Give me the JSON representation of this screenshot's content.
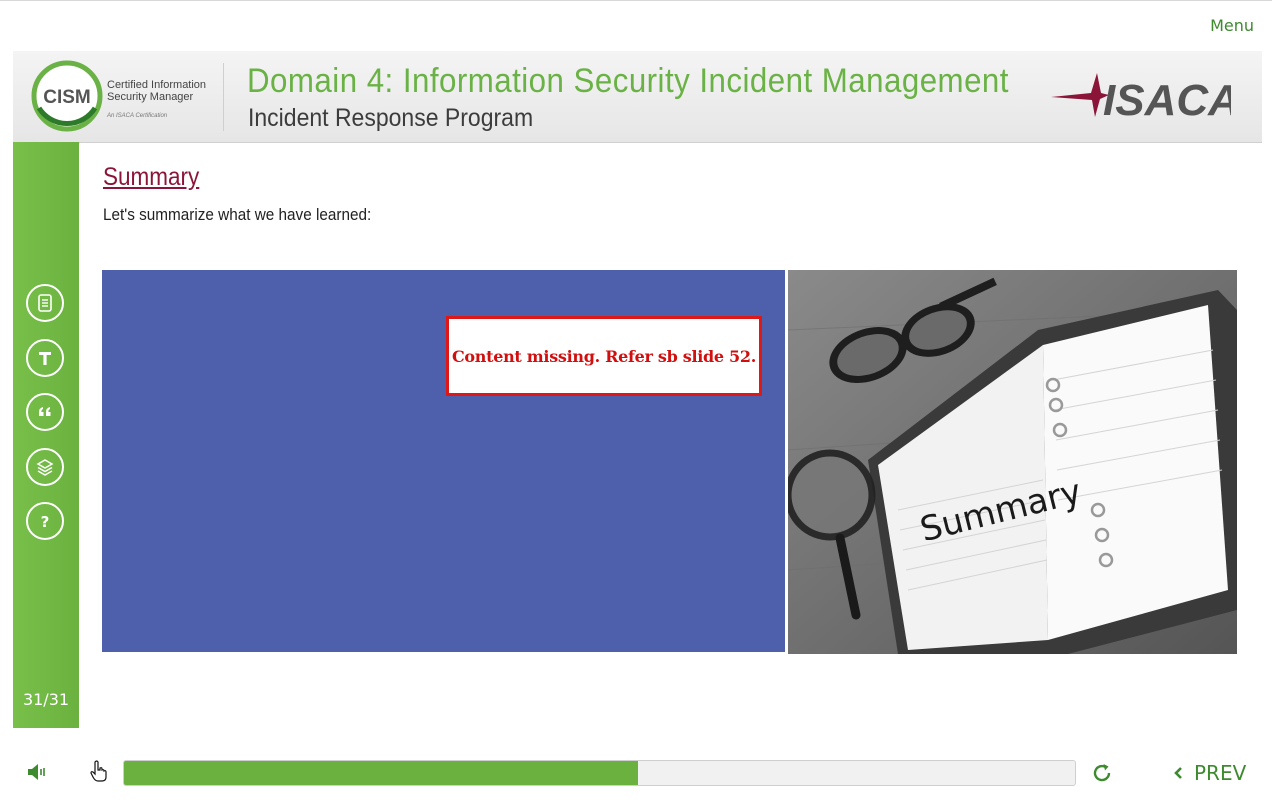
{
  "top": {
    "menu_label": "Menu"
  },
  "header": {
    "cism_logo_text": "CISM",
    "cism_line1": "Certified Information",
    "cism_line2": "Security Manager",
    "cism_tagline": "An ISACA Certification",
    "domain_title": "Domain 4: Information Security Incident Management",
    "subtitle": "Incident Response Program",
    "isaca_logo_text": "ISACA"
  },
  "sidebar": {
    "items": [
      {
        "name": "resources",
        "icon": "document-icon"
      },
      {
        "name": "transcript",
        "icon": "transcript-t-icon"
      },
      {
        "name": "glossary",
        "icon": "quote-icon"
      },
      {
        "name": "layers",
        "icon": "layers-icon"
      },
      {
        "name": "help",
        "icon": "help-icon"
      }
    ],
    "counter": "31/31"
  },
  "slide": {
    "heading": "Summary",
    "intro": "Let's summarize what we have learned:",
    "missing_notice": "Content missing. Refer sb slide 52.",
    "photo_word": "Summary",
    "panel_color": "#4e60ab"
  },
  "player": {
    "progress_percent": 54,
    "prev_label": "PREV",
    "accent": "#6bb13f"
  }
}
